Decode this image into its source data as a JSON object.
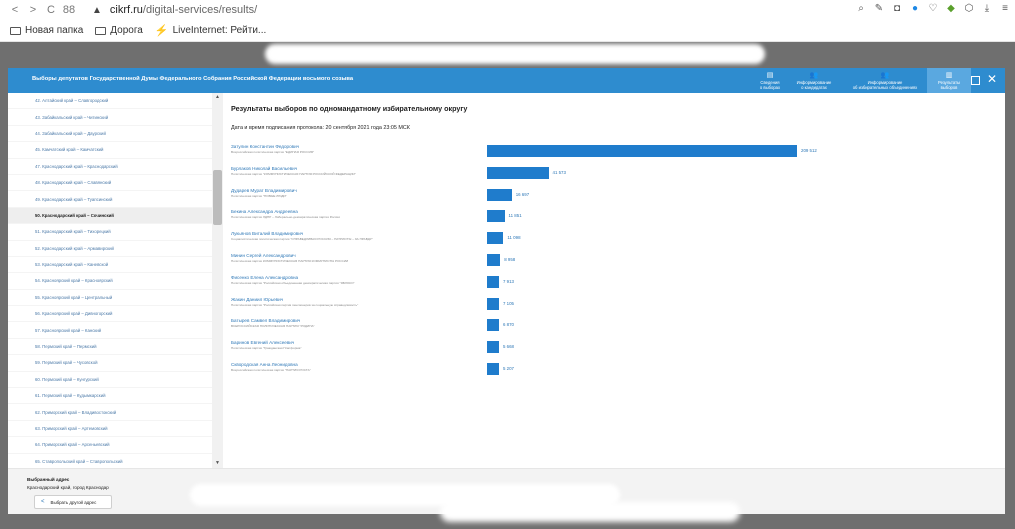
{
  "browser": {
    "back": "<",
    "forward": ">",
    "reload": "C",
    "apps": "88",
    "warn": "▲",
    "url_domain": "cikrf.ru",
    "url_path": "/digital-services/results/"
  },
  "bookmarks": [
    {
      "label": "Новая папка",
      "icon": "folder-icon"
    },
    {
      "label": "Дорога",
      "icon": "folder-icon"
    },
    {
      "label": "LiveInternet: Рейти...",
      "icon": "liveinternet-icon"
    }
  ],
  "modal": {
    "title": "Выборы депутатов Государственной Думы Федерального Собрания Российской Федерации восьмого созыва",
    "tabs": [
      {
        "icon": "▤",
        "label_1": "Сведения",
        "label_2": "о выборах"
      },
      {
        "icon": "👥",
        "label_1": "Информирование",
        "label_2": "о кандидатах"
      },
      {
        "icon": "👥",
        "label_1": "Информирование",
        "label_2": "об избирательных объединениях"
      },
      {
        "icon": "▥",
        "label_1": "Результаты",
        "label_2": "выборов"
      }
    ]
  },
  "regions": [
    "42. Алтайский край – Славгородский",
    "43. Забайкальский край – Читинский",
    "44. Забайкальский край – Даурский",
    "45. Камчатский край – Камчатский",
    "47. Краснодарский край – Краснодарский",
    "48. Краснодарский край – Славянский",
    "49. Краснодарский край – Туапсинский",
    "50. Краснодарский край – Сочинский",
    "51. Краснодарский край – Тихорецкий",
    "52. Краснодарский край – Армавирский",
    "53. Краснодарский край – Каневской",
    "54. Красноярский край – Красноярский",
    "55. Красноярский край – Центральный",
    "56. Красноярский край – Дивногорский",
    "57. Красноярский край – Канский",
    "58. Пермский край – Пермский",
    "59. Пермский край – Чусовской",
    "60. Пермский край – Кунгурский",
    "61. Пермский край – Кудымкарский",
    "62. Приморский край – Владивостокский",
    "63. Приморский край – Артемовский",
    "64. Приморский край – Арсеньевский",
    "65. Ставропольский край – Ставропольский"
  ],
  "active_region_index": 7,
  "results": {
    "title": "Результаты выборов по одномандатному избирательному округу",
    "date": "Дата и время подписания протокола: 20 сентября 2021 года 23:05 МСК",
    "candidates": [
      {
        "name": "Затулин Константин Федорович",
        "party": "Всероссийская политическая партия \"ЕДИНАЯ РОССИЯ\"",
        "votes": 209512,
        "votes_label": "209 512"
      },
      {
        "name": "Бурлаков Николай Васильевич",
        "party": "Политическая партия \"КОММУНИСТИЧЕСКАЯ ПАРТИЯ РОССИЙСКОЙ ФЕДЕРАЦИИ\"",
        "votes": 41573,
        "votes_label": "41 573"
      },
      {
        "name": "Дударев Мурат Владимирович",
        "party": "Политическая партия \"НОВЫЕ ЛЮДИ\"",
        "votes": 16697,
        "votes_label": "16 697"
      },
      {
        "name": "Бекина Александра Андреевна",
        "party": "Политическая партия ЛДПР – Либерально-демократическая партия России",
        "votes": 11851,
        "votes_label": "11 851"
      },
      {
        "name": "Лукьянов Виталий Владимирович",
        "party": "Социалистическая политическая партия \"СПРАВЕДЛИВАЯ РОССИЯ – ПАТРИОТЫ – ЗА ПРАВДУ\"",
        "votes": 11098,
        "votes_label": "11 098"
      },
      {
        "name": "Минин Сергей Александрович",
        "party": "Политическая партия КОММУНИСТИЧЕСКАЯ ПАРТИЯ КОММУНИСТЫ РОССИИ",
        "votes": 8958,
        "votes_label": "8 958"
      },
      {
        "name": "Фисенко Елена Александровна",
        "party": "Политическая партия \"Российская объединенная демократическая партия \"ЯБЛОКО\"",
        "votes": 7913,
        "votes_label": "7 913"
      },
      {
        "name": "Жакин Даниил Юрьевич",
        "party": "Политическая партия \"Российская партия пенсионеров за социальную справедливость\"",
        "votes": 7105,
        "votes_label": "7 105"
      },
      {
        "name": "Батырев Самвел Владимирович",
        "party": "ВСЕРОССИЙСКАЯ ПОЛИТИЧЕСКАЯ ПАРТИЯ \"РОДИНА\"",
        "votes": 6870,
        "votes_label": "6 870"
      },
      {
        "name": "Баринов Евгений Алексеевич",
        "party": "Политическая партия \"Гражданская Платформа\"",
        "votes": 5668,
        "votes_label": "5 668"
      },
      {
        "name": "Сквородская Анна Леонидовна",
        "party": "Всероссийская политическая партия \"ПАРТИЯ РОСТА\"",
        "votes": 5207,
        "votes_label": "5 207"
      }
    ]
  },
  "chart_data": {
    "type": "bar",
    "categories": [
      "Затулин Константин Федорович",
      "Бурлаков Николай Васильевич",
      "Дударев Мурат Владимирович",
      "Бекина Александра Андреевна",
      "Лукьянов Виталий Владимирович",
      "Минин Сергей Александрович",
      "Фисенко Елена Александровна",
      "Жакин Даниил Юрьевич",
      "Батырев Самвел Владимирович",
      "Баринов Евгений Алексеевич",
      "Сквородская Анна Леонидовна"
    ],
    "values": [
      209512,
      41573,
      16697,
      11851,
      11098,
      8958,
      7913,
      7105,
      6870,
      5668,
      5207
    ],
    "title": "Результаты выборов по одномандатному избирательному округу",
    "orientation": "horizontal",
    "color": "#1f7ccc"
  },
  "footer": {
    "label": "Выбранный адрес",
    "address": "Краснодарский край, город Краснодар",
    "change_button": "Выбрать другой адрес",
    "chevron": "<"
  },
  "colors": {
    "header": "#2e8ccf",
    "bar": "#1f7ccc",
    "link": "#2e78b7"
  }
}
